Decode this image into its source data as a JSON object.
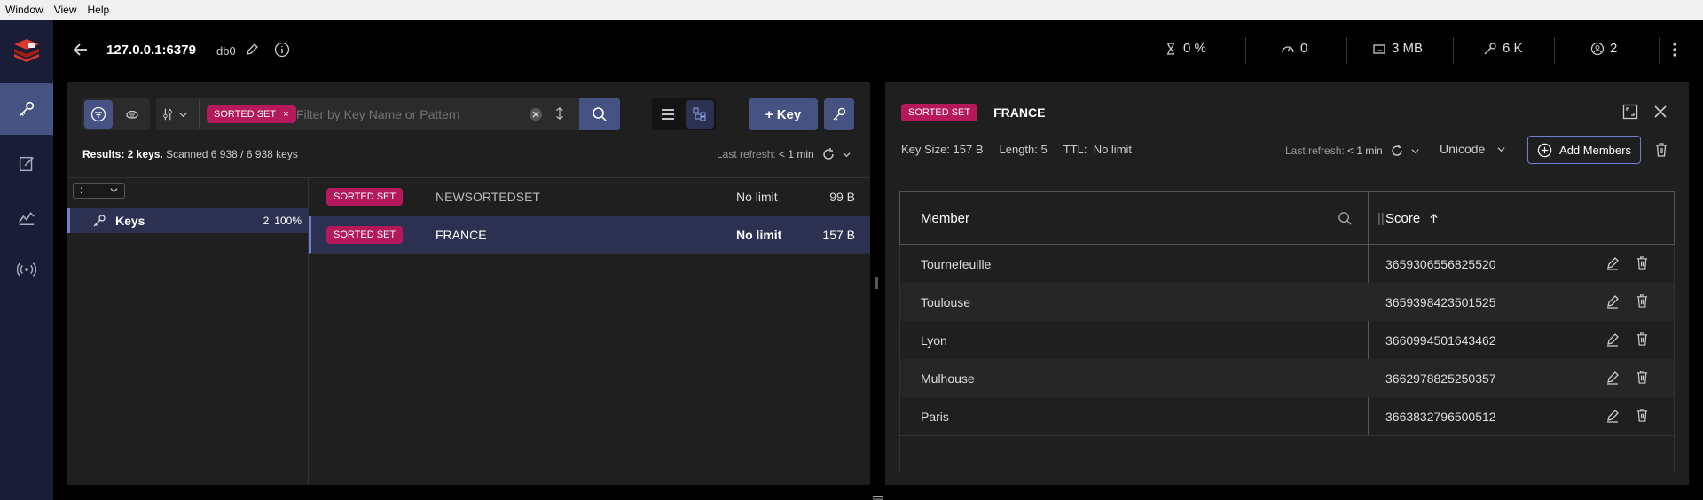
{
  "menubar": [
    "Window",
    "View",
    "Help"
  ],
  "header": {
    "host": "127.0.0.1:6379",
    "db": "db0",
    "stats": {
      "cpu": "0 %",
      "ops": "0",
      "memory": "3 MB",
      "keys": "6 K",
      "clients": "2"
    }
  },
  "sidebar": {
    "items": [
      "browser",
      "workbench",
      "analysis",
      "pubsub"
    ],
    "active": "browser"
  },
  "filter": {
    "type_tag": "SORTED SET",
    "placeholder": "Filter by Key Name or Pattern"
  },
  "toolbar": {
    "add_key_label": "+ Key"
  },
  "results": {
    "label": "Results: 2 keys.",
    "scanned": "Scanned 6 938 / 6 938 keys",
    "refresh_label": "Last refresh:",
    "refresh_value": "< 1 min"
  },
  "tree": {
    "select_value": ":",
    "keys_label": "Keys",
    "keys_count": "2",
    "keys_percent": "100%"
  },
  "key_list": [
    {
      "type": "SORTED SET",
      "name": "NEWSORTEDSET",
      "ttl": "No limit",
      "size": "99 B"
    },
    {
      "type": "SORTED SET",
      "name": "FRANCE",
      "ttl": "No limit",
      "size": "157 B"
    }
  ],
  "detail": {
    "type": "SORTED SET",
    "name": "FRANCE",
    "key_size": "Key Size: 157 B",
    "length": "Length: 5",
    "ttl_label": "TTL:",
    "ttl_value": "No limit",
    "refresh_label": "Last refresh:",
    "refresh_value": "< 1 min",
    "encoding": "Unicode",
    "add_members_label": "Add Members",
    "columns": {
      "member": "Member",
      "score": "Score"
    },
    "rows": [
      {
        "member": "Tournefeuille",
        "score": "3659306556825520"
      },
      {
        "member": "Toulouse",
        "score": "3659398423501525"
      },
      {
        "member": "Lyon",
        "score": "3660994501643462"
      },
      {
        "member": "Mulhouse",
        "score": "3662978825250357"
      },
      {
        "member": "Paris",
        "score": "3663832796500512"
      }
    ]
  },
  "colors": {
    "accent": "#465282",
    "tag": "#b5195c",
    "sidebar": "#1a1d37",
    "panel": "#1f1f1f"
  }
}
